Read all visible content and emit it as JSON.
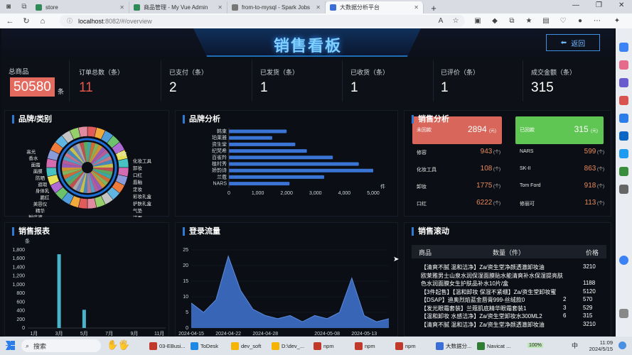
{
  "browser": {
    "tabs": [
      {
        "title": "store",
        "color": "#2e8b57",
        "active": false
      },
      {
        "title": "商品管理 - My Vue Admin",
        "color": "#2e8b57",
        "active": false
      },
      {
        "title": "from-to-mysql - Spark Jobs",
        "color": "#777777",
        "active": false
      },
      {
        "title": "大数据分析平台",
        "color": "#3b6fd6",
        "active": true
      }
    ],
    "url_host": "localhost",
    "url_path": ":8082/#/overview"
  },
  "dashboard": {
    "title": "销售看板",
    "back_label": "返回",
    "stats": [
      {
        "label": "总商品",
        "value": "50580",
        "unit": "条"
      },
      {
        "label": "订单总数（条）",
        "value": "11"
      },
      {
        "label": "已支付（条）",
        "value": "2"
      },
      {
        "label": "已发货（条）",
        "value": "1"
      },
      {
        "label": "已收货（条）",
        "value": "1"
      },
      {
        "label": "已评价（条）",
        "value": "1"
      },
      {
        "label": "成交金额（条）",
        "value": "315"
      }
    ],
    "panels": {
      "brand_category": "品牌/类别",
      "brand_analysis": "品牌分析",
      "sales_analysis": "销售分析",
      "sales_report": "销售报表",
      "login_flow": "登录流量",
      "sales_scroll": "销售滚动"
    },
    "pie_labels_left": [
      "高光",
      "香水",
      "面霜",
      "面膜",
      "防晒",
      "遮瑕",
      "身体乳",
      "腮红",
      "美容仪",
      "精华",
      "粉底液",
      "眼霜",
      "眼影",
      "男士护肤"
    ],
    "pie_labels_right": [
      "修容",
      "化妆工具",
      "卸妆",
      "口红",
      "唇釉",
      "定妆",
      "彩妆礼盒",
      "护肤礼盒",
      "气垫",
      "洁面",
      "润唇膏"
    ],
    "pie_colors": [
      "#e05b5b",
      "#f2a93b",
      "#4f9ddb",
      "#6cc36c",
      "#b06ad4",
      "#e7e157",
      "#47c1c1",
      "#d56bb0",
      "#8a9bd9",
      "#f07c3c",
      "#5fb6e3",
      "#c4c4c4",
      "#96d06b",
      "#e28aa0"
    ],
    "sales_analysis": {
      "unpaid_label": "未回款",
      "unpaid_value": "2894",
      "paid_label": "已回款",
      "paid_value": "315",
      "unit": "(元)",
      "item_unit": "(个)",
      "items_left": [
        {
          "name": "修容",
          "value": "943"
        },
        {
          "name": "化妆工具",
          "value": "108"
        },
        {
          "name": "卸妆",
          "value": "1775"
        },
        {
          "name": "口红",
          "value": "6222"
        }
      ],
      "items_right": [
        {
          "name": "NARS",
          "value": "599"
        },
        {
          "name": "SK-II",
          "value": "863"
        },
        {
          "name": "Tom Ford",
          "value": "918"
        },
        {
          "name": "修丽可",
          "value": "113"
        }
      ]
    },
    "scroll": {
      "headers": [
        "商品",
        "数量（件）",
        "价格"
      ],
      "rows": [
        {
          "text": "【清爽不腻 温和洁净】Za/资生堂净颜透澈卸妆油",
          "qty": "",
          "price": "3210"
        },
        {
          "text": "欧莱雅男士山泉水润保湿面膜贴水能清爽补水保湿提亮肤",
          "qty": "",
          "price": ""
        },
        {
          "text": "色水润面膜女生护肤品补水10片/盒",
          "qty": "",
          "price": "1188"
        },
        {
          "text": "【3件起售】【温和卸妆 保湿不紧绷】Za/资生堂卸妆蜜",
          "qty": "",
          "price": "5120"
        },
        {
          "text": "【DSAP】迪奥烈焰蓝金唇膏999-丝绒款0",
          "qty": "2",
          "price": "570"
        },
        {
          "text": "【发光眼霜套装】兰蔻肌底精华眼霜套装1",
          "qty": "3",
          "price": "529"
        },
        {
          "text": "【温和卸妆 水感洁净】Za/资生堂卸妆水300ML2",
          "qty": "6",
          "price": "315"
        },
        {
          "text": "【清爽不腻 温和洁净】Za/资生堂净颜透澈卸妆油",
          "qty": "",
          "price": "3210"
        }
      ]
    }
  },
  "chart_data": [
    {
      "type": "bar",
      "title": "品牌分析",
      "orientation": "horizontal",
      "categories": [
        "韩束",
        "珀莱雅",
        "资生堂",
        "纪梵希",
        "百雀羚",
        "植村秀",
        "娇韵诗",
        "兰蔻",
        "NARS"
      ],
      "values": [
        2000,
        1500,
        2300,
        2700,
        3600,
        4500,
        5000,
        3300,
        2100
      ],
      "xlim": [
        0,
        5000
      ],
      "xticks": [
        "0",
        "1,000",
        "2,000",
        "3,000",
        "4,000",
        "5,000"
      ],
      "xlabel": "件"
    },
    {
      "type": "bar",
      "title": "销售报表",
      "categories": [
        "1月",
        "2月",
        "3月",
        "4月",
        "5月",
        "6月",
        "7月",
        "8月",
        "9月",
        "10月",
        "11月"
      ],
      "xticks": [
        "1月",
        "3月",
        "5月",
        "7月",
        "9月",
        "11月"
      ],
      "values": [
        0,
        0,
        1700,
        0,
        420,
        0,
        0,
        0,
        0,
        0,
        0
      ],
      "ylim": [
        0,
        1800
      ],
      "yticks": [
        "0",
        "200",
        "400",
        "600",
        "800",
        "1,000",
        "1,200",
        "1,400",
        "1,600",
        "1,800"
      ],
      "ylabel": "条"
    },
    {
      "type": "area",
      "title": "登录流量",
      "x": [
        "2024-04-15",
        "2024-04-18",
        "2024-04-20",
        "2024-04-22",
        "2024-04-24",
        "2024-04-26",
        "2024-04-28",
        "2024-04-30",
        "2024-05-02",
        "2024-05-04",
        "2024-05-06",
        "2024-05-08",
        "2024-05-10",
        "2024-05-12",
        "2024-05-13",
        "2024-05-14",
        "2024-05-15"
      ],
      "values": [
        8,
        5,
        9,
        23,
        12,
        6,
        4,
        3,
        4,
        2,
        4,
        3,
        5,
        16,
        4,
        2,
        3
      ],
      "ylim": [
        0,
        25
      ],
      "yticks": [
        "0",
        "5",
        "10",
        "15",
        "20",
        "25"
      ],
      "xticks": [
        "2024-04-15",
        "2024-04-22",
        "2024-04-28",
        "2024-05-08",
        "2024-05-13"
      ]
    }
  ],
  "taskbar": {
    "search_label": "搜索",
    "items": [
      "03-EBusi...",
      "ToDesk",
      "dev_soft",
      "D:\\dev_...",
      "npm",
      "npm",
      "npm",
      "大数据分...",
      "Navicat ..."
    ],
    "battery": "100%",
    "ime": "中",
    "time": "11:09",
    "date": "2024/5/15"
  }
}
